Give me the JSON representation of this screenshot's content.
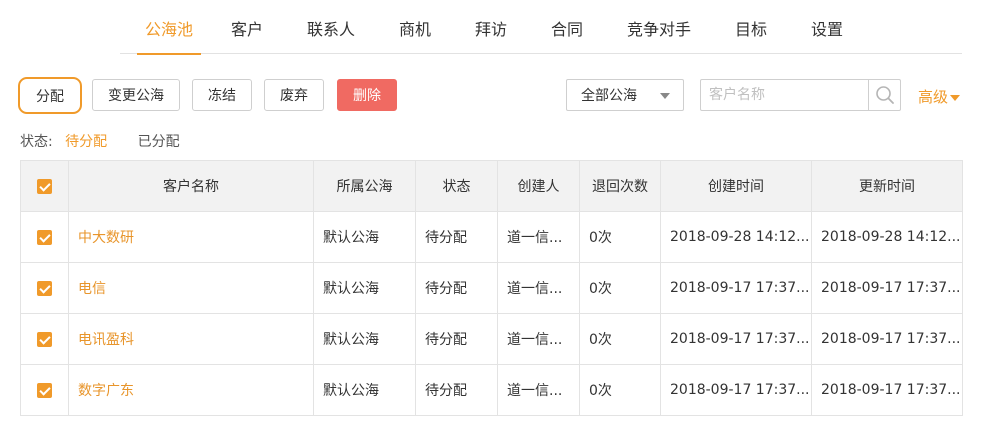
{
  "nav": {
    "tabs": [
      {
        "label": "公海池",
        "active": true
      },
      {
        "label": "客户"
      },
      {
        "label": "联系人"
      },
      {
        "label": "商机"
      },
      {
        "label": "拜访"
      },
      {
        "label": "合同"
      },
      {
        "label": "竞争对手"
      },
      {
        "label": "目标"
      },
      {
        "label": "设置"
      }
    ]
  },
  "toolbar": {
    "assign": "分配",
    "change_pool": "变更公海",
    "freeze": "冻结",
    "discard": "废弃",
    "delete": "删除"
  },
  "filter": {
    "pool_select": "全部公海",
    "search_placeholder": "客户名称",
    "advanced": "高级"
  },
  "status": {
    "label": "状态:",
    "options": [
      "待分配",
      "已分配"
    ],
    "active": "待分配"
  },
  "table": {
    "columns": [
      "客户名称",
      "所属公海",
      "状态",
      "创建人",
      "退回次数",
      "创建时间",
      "更新时间"
    ],
    "rows": [
      {
        "checked": true,
        "name": "中大数研",
        "pool": "默认公海",
        "status": "待分配",
        "creator": "道一信...",
        "returns": "0次",
        "created": "2018-09-28 14:12...",
        "updated": "2018-09-28 14:12..."
      },
      {
        "checked": true,
        "name": "电信",
        "pool": "默认公海",
        "status": "待分配",
        "creator": "道一信...",
        "returns": "0次",
        "created": "2018-09-17 17:37...",
        "updated": "2018-09-17 17:37..."
      },
      {
        "checked": true,
        "name": "电讯盈科",
        "pool": "默认公海",
        "status": "待分配",
        "creator": "道一信...",
        "returns": "0次",
        "created": "2018-09-17 17:37...",
        "updated": "2018-09-17 17:37..."
      },
      {
        "checked": true,
        "name": "数字广东",
        "pool": "默认公海",
        "status": "待分配",
        "creator": "道一信...",
        "returns": "0次",
        "created": "2018-09-17 17:37...",
        "updated": "2018-09-17 17:37..."
      }
    ]
  },
  "colors": {
    "accent": "#f09a2a",
    "danger": "#f06a62",
    "border": "#e3e3e3",
    "header_bg": "#f2f2f2"
  }
}
